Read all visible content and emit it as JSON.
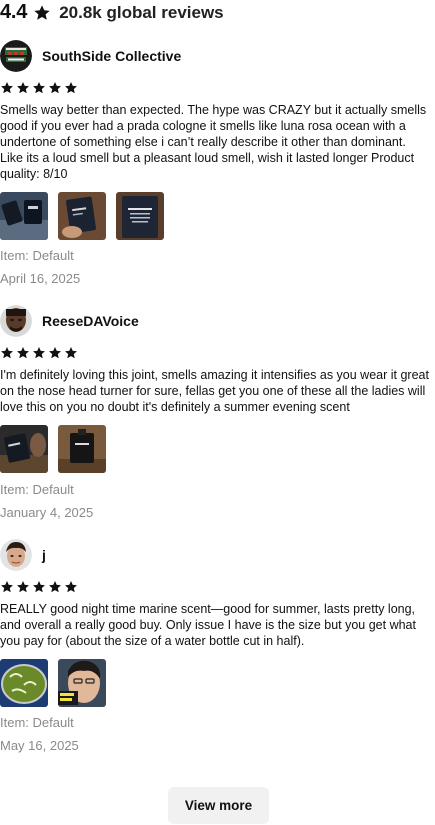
{
  "summary": {
    "rating": "4.4",
    "review_count": "20.8k global reviews"
  },
  "reviews": [
    {
      "reviewer": "SouthSide Collective",
      "stars": 5,
      "text": "Smells way better than expected. The hype was CRAZY but it actually smells good if you ever had a prada cologne it smells like luna rosa ocean with a undertone of something else i can’t really describe it other than dominant. Like its a loud smell but a pleasant loud smell, wish it lasted longer Product quality: 8/10",
      "item": "Item: Default",
      "date": "April 16, 2025",
      "photo_count": 3
    },
    {
      "reviewer": "ReeseDAVoice",
      "stars": 5,
      "text": "I'm definitely loving this joint, smells amazing it intensifies as you wear it great on the nose head turner for sure, fellas get you one of these all the ladies will love this on you no doubt it's definitely a summer evening scent",
      "item": "Item: Default",
      "date": "January 4, 2025",
      "photo_count": 2
    },
    {
      "reviewer": "j",
      "stars": 5,
      "text": "REALLY good night time marine scent—good for summer, lasts pretty long, and overall a really good buy. Only issue I have is the size but you get what you pay for (about the size of a water bottle cut in half).",
      "item": "Item: Default",
      "date": "May 16, 2025",
      "photo_count": 2
    }
  ],
  "view_more_label": "View more",
  "colors": {
    "star": "#111111",
    "meta_text": "#8a8a8a",
    "button_bg": "#f1f1f1"
  },
  "icons": {
    "star": "star-icon"
  }
}
